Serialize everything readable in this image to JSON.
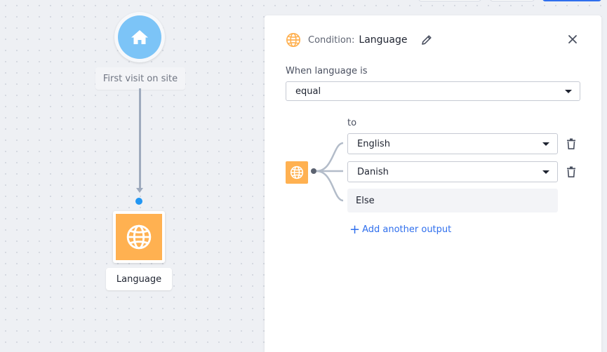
{
  "canvas": {
    "trigger": {
      "label": "First visit on site",
      "icon": "home-icon"
    },
    "condition_node": {
      "label": "Language",
      "icon": "globe-icon",
      "color": "#ffb151"
    }
  },
  "panel": {
    "title_prefix": "Condition:",
    "title": "Language",
    "field_label": "When language is",
    "operator": {
      "selected": "equal"
    },
    "to_label": "to",
    "outputs": [
      {
        "value": "English"
      },
      {
        "value": "Danish"
      }
    ],
    "else_label": "Else",
    "add_output_label": "Add another output"
  },
  "colors": {
    "accent": "#2f6fed",
    "node_orange": "#ffb151",
    "home_blue": "#7cc4f7",
    "connector_dot": "#2196f3"
  }
}
